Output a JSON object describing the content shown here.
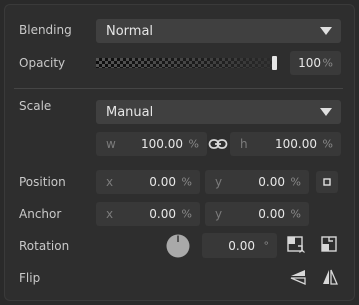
{
  "blending": {
    "label": "Blending",
    "value": "Normal"
  },
  "opacity": {
    "label": "Opacity",
    "value": "100",
    "unit": "%",
    "level": 1.0
  },
  "scale": {
    "label": "Scale",
    "mode": "Manual",
    "w": {
      "prefix": "w",
      "value": "100.00",
      "unit": "%"
    },
    "h": {
      "prefix": "h",
      "value": "100.00",
      "unit": "%"
    }
  },
  "position": {
    "label": "Position",
    "x": {
      "prefix": "x",
      "value": "0.00",
      "unit": "%"
    },
    "y": {
      "prefix": "y",
      "value": "0.00",
      "unit": "%"
    }
  },
  "anchor": {
    "label": "Anchor",
    "x": {
      "prefix": "x",
      "value": "0.00",
      "unit": "%"
    },
    "y": {
      "prefix": "y",
      "value": "0.00",
      "unit": "%"
    }
  },
  "rotation": {
    "label": "Rotation",
    "value": "0.00",
    "unit": "°"
  },
  "flip": {
    "label": "Flip"
  }
}
